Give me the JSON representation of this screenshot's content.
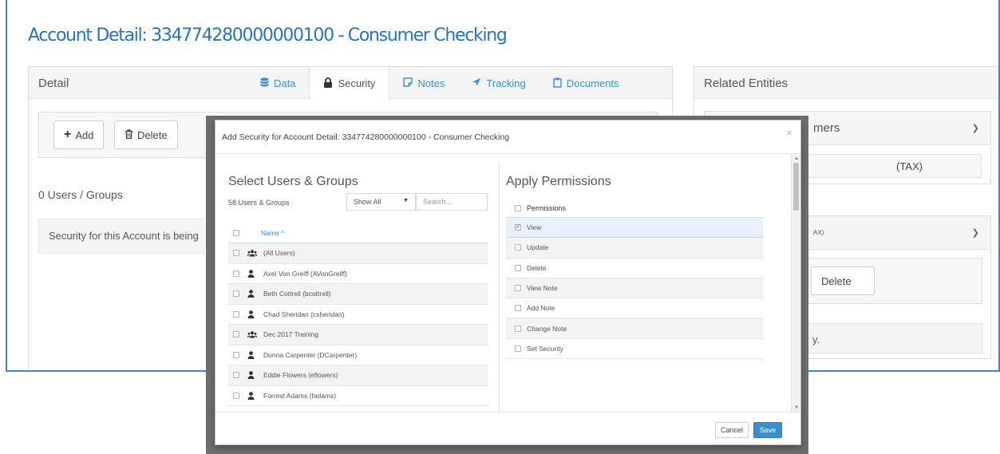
{
  "page": {
    "title": "Account Detail: 334774280000000100 - Consumer Checking"
  },
  "detail_panel": {
    "heading": "Detail",
    "tabs": [
      {
        "label": "Data",
        "icon": "database-icon"
      },
      {
        "label": "Security",
        "icon": "lock-icon",
        "active": true
      },
      {
        "label": "Notes",
        "icon": "note-icon"
      },
      {
        "label": "Tracking",
        "icon": "location-arrow-icon"
      },
      {
        "label": "Documents",
        "icon": "clipboard-icon"
      }
    ],
    "add_label": "Add",
    "delete_label": "Delete",
    "count_label": "0 Users / Groups",
    "notice": "Security for this Account is being"
  },
  "related_panel": {
    "heading": "Related Entities",
    "item1_title": "mers",
    "item1_value": "(TAX)",
    "item2_fragment": "AX)",
    "delete_label": "Delete",
    "notice_fragment": "y."
  },
  "modal": {
    "title": "Add Security for Account Detail: 334774280000000100 - Consumer Checking",
    "close_symbol": "×",
    "left": {
      "heading": "Select Users & Groups",
      "count": "58 Users & Groups",
      "filter_value": "Show All",
      "search_placeholder": "Search...",
      "column_header": "Name ^",
      "rows": [
        {
          "name": "(All Users)",
          "type": "group"
        },
        {
          "name": "Axel Von Greiff (AVonGreiff)",
          "type": "user"
        },
        {
          "name": "Beth Cottrell (bcottrell)",
          "type": "user"
        },
        {
          "name": "Chad Sheridan (csheridan)",
          "type": "user"
        },
        {
          "name": "Dec 2017 Training",
          "type": "group"
        },
        {
          "name": "Donna Carpenter (DCarpenter)",
          "type": "user"
        },
        {
          "name": "Eddie Flowers (eflowers)",
          "type": "user"
        },
        {
          "name": "Forrest Adams (fadams)",
          "type": "user"
        }
      ]
    },
    "right": {
      "heading": "Apply Permissions",
      "column_header": "Permissions",
      "rows": [
        {
          "name": "View",
          "checked": true
        },
        {
          "name": "Update",
          "checked": false
        },
        {
          "name": "Delete",
          "checked": false
        },
        {
          "name": "View Note",
          "checked": false
        },
        {
          "name": "Add Note",
          "checked": false
        },
        {
          "name": "Change Note",
          "checked": false
        },
        {
          "name": "Set Security",
          "checked": false
        }
      ]
    },
    "cancel_label": "Cancel",
    "save_label": "Save"
  },
  "colors": {
    "accent": "#2a73b8",
    "link": "#3b8fd3",
    "frame_border": "#4a7fc1",
    "save_button": "#3c8dcf",
    "selected_row": "#e8f1fb"
  }
}
